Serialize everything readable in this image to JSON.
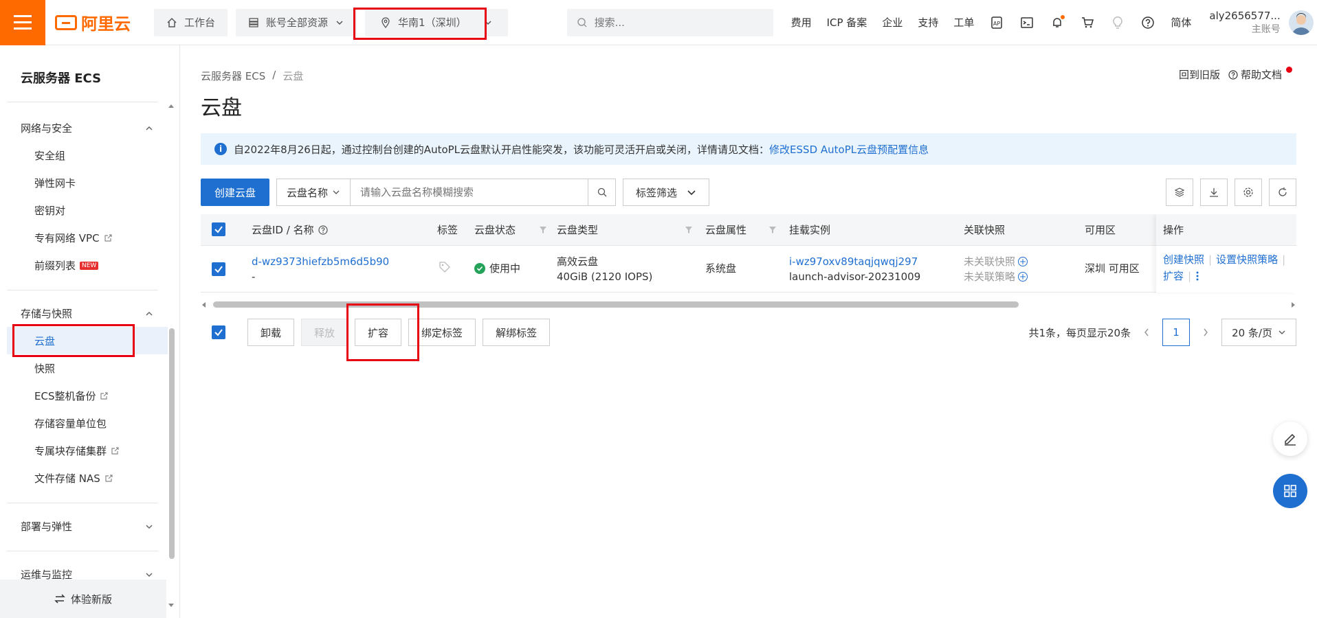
{
  "topbar": {
    "logo_text": "阿里云",
    "workbench": "工作台",
    "resources": "账号全部资源",
    "region": "华南1（深圳）",
    "search_placeholder": "搜索...",
    "links": [
      "费用",
      "ICP 备案",
      "企业",
      "支持",
      "工单"
    ],
    "lang": "简体",
    "user_name": "aly2656577...",
    "user_role": "主账号"
  },
  "sidebar": {
    "title": "云服务器 ECS",
    "groups": [
      {
        "label": "网络与安全",
        "items": [
          "安全组",
          "弹性网卡",
          "密钥对",
          "专有网络 VPC",
          "前缀列表"
        ]
      },
      {
        "label": "存储与快照",
        "items": [
          "云盘",
          "快照",
          "ECS整机备份",
          "存储容量单位包",
          "专属块存储集群",
          "文件存储 NAS"
        ]
      },
      {
        "label": "部署与弹性",
        "items": []
      },
      {
        "label": "运维与监控",
        "items": []
      }
    ],
    "new_badge": "NEW",
    "bottom_label": "体验新版"
  },
  "main": {
    "breadcrumb": [
      "云服务器 ECS",
      "/",
      "云盘"
    ],
    "title": "云盘",
    "back_old": "回到旧版",
    "help_doc": "帮助文档",
    "notice_text": "自2022年8月26日起，通过控制台创建的AutoPL云盘默认开启性能突发，该功能可灵活开启或关闭，详情请见文档：",
    "notice_link": "修改ESSD AutoPL云盘预配置信息",
    "create_button": "创建云盘",
    "search_field": "云盘名称",
    "search_placeholder": "请输入云盘名称模糊搜索",
    "tag_filter": "标签筛选"
  },
  "table": {
    "headers": {
      "id_name": "云盘ID / 名称",
      "tag": "标签",
      "status": "云盘状态",
      "type": "云盘类型",
      "attr": "云盘属性",
      "instance": "挂载实例",
      "snapshot": "关联快照",
      "zone": "可用区",
      "ops": "操作"
    },
    "rows": [
      {
        "id": "d-wz9373hiefzb5m6d5b90",
        "name": "-",
        "status": "使用中",
        "type": "高效云盘",
        "size": "40GiB (2120 IOPS)",
        "attr": "系统盘",
        "instance_id": "i-wz97oxv89taqjqwqj297",
        "instance_name": "launch-advisor-20231009",
        "snapshot1": "未关联快照",
        "snapshot2": "未关联策略",
        "zone": "深圳 可用区",
        "ops": [
          "创建快照",
          "设置快照策略",
          "扩容"
        ]
      }
    ]
  },
  "footer": {
    "buttons": [
      "卸载",
      "释放",
      "扩容",
      "绑定标签",
      "解绑标签"
    ],
    "total_text": "共1条，每页显示20条",
    "page": "1",
    "page_size": "20 条/页"
  },
  "colors": {
    "brand": "#ff6a00",
    "primary": "#1f6fd1",
    "highlight": "#e60012",
    "success": "#25a35a"
  }
}
